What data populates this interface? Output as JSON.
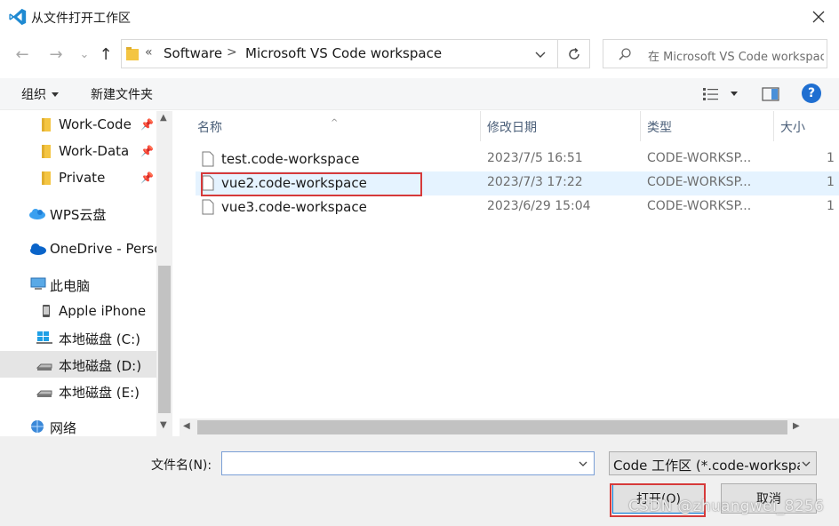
{
  "window": {
    "title": "从文件打开工作区",
    "close_glyph": "✕"
  },
  "nav": {
    "back_glyph": "←",
    "forward_glyph": "→",
    "recent_glyph": "⌄",
    "up_glyph": "↑"
  },
  "address": {
    "chevron": "«",
    "crumbs": [
      "Software",
      "Microsoft VS Code workspace"
    ],
    "separator": ">"
  },
  "search": {
    "placeholder": "在 Microsoft VS Code workspace 中搜索"
  },
  "commandbar": {
    "organize_label": "组织",
    "new_folder_label": "新建文件夹",
    "help_label": "?"
  },
  "sidebar": {
    "items": [
      {
        "label": "Work-Code",
        "icon": "folder-icon",
        "pinned": true
      },
      {
        "label": "Work-Data",
        "icon": "folder-icon",
        "pinned": true
      },
      {
        "label": "Private",
        "icon": "folder-icon",
        "pinned": true
      },
      {
        "label": "WPS云盘",
        "icon": "cloud-icon"
      },
      {
        "label": "OneDrive - Perso",
        "icon": "onedrive-icon"
      },
      {
        "label": "此电脑",
        "icon": "computer-icon"
      },
      {
        "label": "Apple iPhone",
        "icon": "phone-icon"
      },
      {
        "label": "本地磁盘 (C:)",
        "icon": "windows-drive-icon"
      },
      {
        "label": "本地磁盘 (D:)",
        "icon": "drive-icon",
        "selected": true
      },
      {
        "label": "本地磁盘 (E:)",
        "icon": "drive-icon"
      },
      {
        "label": "网络",
        "icon": "network-icon"
      }
    ]
  },
  "columns": {
    "name": "名称",
    "date": "修改日期",
    "type": "类型",
    "size": "大小",
    "sort_glyph": "^"
  },
  "files": [
    {
      "name": "test.code-workspace",
      "date": "2023/7/5 16:51",
      "type": "CODE-WORKSP...",
      "size": "1"
    },
    {
      "name": "vue2.code-workspace",
      "date": "2023/7/3 17:22",
      "type": "CODE-WORKSP...",
      "size": "1",
      "selected": true
    },
    {
      "name": "vue3.code-workspace",
      "date": "2023/6/29 15:04",
      "type": "CODE-WORKSP...",
      "size": "1"
    }
  ],
  "footer": {
    "filename_label": "文件名(N):",
    "filename_value": "",
    "filter_value": "Code 工作区 (*.code-workspace)",
    "open_label": "打开(O)",
    "cancel_label": "取消"
  },
  "watermark": "CSDN @zhuangwei_8256",
  "colors": {
    "vscode_blue": "#007acc",
    "selection": "#cce8ff",
    "row_selected": "#e5f3ff",
    "highlight_red": "#d63a3a",
    "folder_yellow": "#f4c542"
  }
}
